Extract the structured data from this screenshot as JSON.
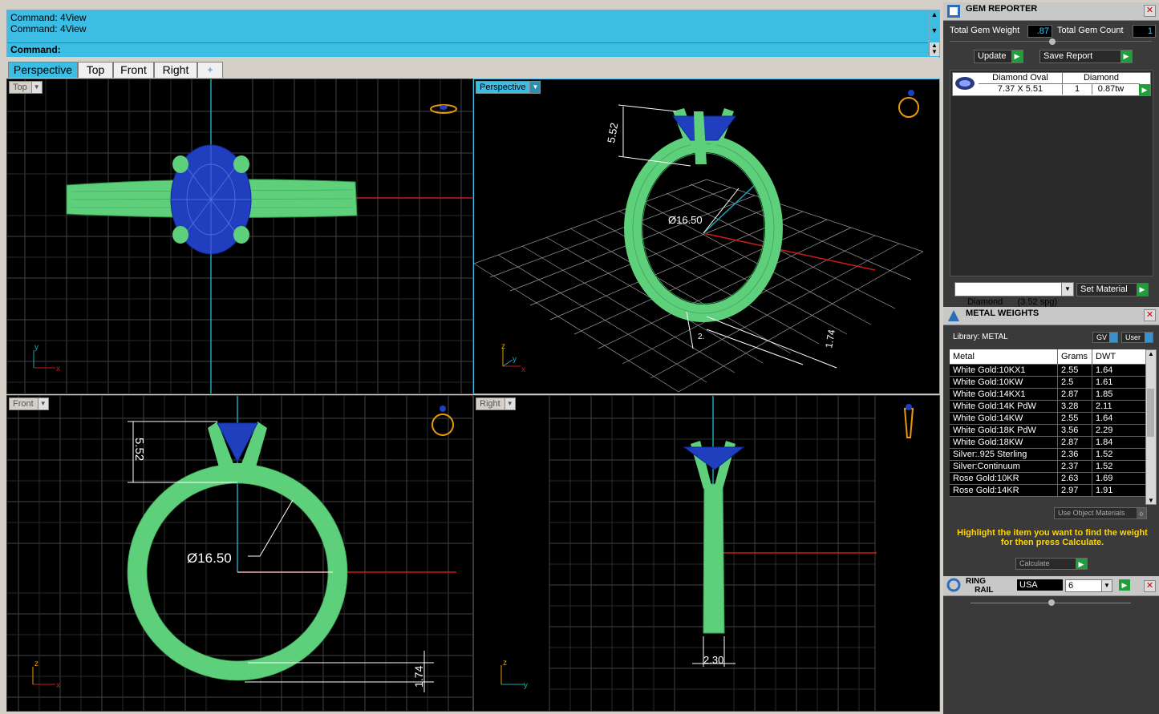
{
  "command": {
    "history": [
      "Command: 4View",
      "Command: 4View"
    ],
    "prompt_label": "Command:"
  },
  "tabs": [
    {
      "label": "Perspective",
      "active": true
    },
    {
      "label": "Top",
      "active": false
    },
    {
      "label": "Front",
      "active": false
    },
    {
      "label": "Right",
      "active": false
    },
    {
      "label": "+",
      "active": false
    }
  ],
  "viewports": {
    "top": {
      "label": "Top"
    },
    "perspective": {
      "label": "Perspective"
    },
    "front": {
      "label": "Front"
    },
    "right": {
      "label": "Right"
    }
  },
  "dimensions": {
    "persp_height": "5.52",
    "persp_diameter": "Ø16.50",
    "persp_small": "2.",
    "persp_thick": "1.74",
    "front_height": "5.52",
    "front_diameter": "Ø16.50",
    "front_thick": "1.74",
    "right_width": "2.30"
  },
  "axes": {
    "x": "x",
    "y": "y",
    "z": "z"
  },
  "gem_reporter": {
    "title": "GEM REPORTER",
    "total_weight_label": "Total Gem Weight",
    "total_weight_value": ".87",
    "total_count_label": "Total Gem Count",
    "total_count_value": "1",
    "update_label": "Update",
    "save_label": "Save Report",
    "gem": {
      "name": "Diamond Oval",
      "size": "7.37 X 5.51",
      "type": "Diamond",
      "count": "1",
      "weight": "0.87tw"
    },
    "material_select": "Diamond      (3.52 spg)",
    "set_material_label": "Set Material"
  },
  "metal_weights": {
    "title": "METAL WEIGHTS",
    "library_label": "Library: METAL",
    "gv_label": "GV",
    "user_label": "User",
    "columns": [
      "Metal",
      "Grams",
      "DWT"
    ],
    "rows": [
      [
        "White Gold:10KX1",
        "2.55",
        "1.64"
      ],
      [
        "White Gold:10KW",
        "2.5",
        "1.61"
      ],
      [
        "White Gold:14KX1",
        "2.87",
        "1.85"
      ],
      [
        "White Gold:14K PdW",
        "3.28",
        "2.11"
      ],
      [
        "White Gold:14KW",
        "2.55",
        "1.64"
      ],
      [
        "White Gold:18K PdW",
        "3.56",
        "2.29"
      ],
      [
        "White Gold:18KW",
        "2.87",
        "1.84"
      ],
      [
        "Silver:.925 Sterling",
        "2.36",
        "1.52"
      ],
      [
        "Silver:Continuum",
        "2.37",
        "1.52"
      ],
      [
        "Rose Gold:10KR",
        "2.63",
        "1.69"
      ],
      [
        "Rose Gold:14KR",
        "2.97",
        "1.91"
      ]
    ],
    "use_object_label": "Use Object Materials",
    "hint": "Highlight the item you want to find the weight for then press Calculate.",
    "calculate_label": "Calculate"
  },
  "ring_rail": {
    "title_line1": "RING",
    "title_line2": "RAIL",
    "country": "USA",
    "size": "6"
  },
  "colors": {
    "ring_green": "#5ecf7a",
    "gem_blue": "#1f3fbf",
    "cad_bg": "#000000",
    "accent_cyan": "#3cbde3",
    "axis_red": "#cc1b1b",
    "axis_cyan": "#1da3b8"
  }
}
